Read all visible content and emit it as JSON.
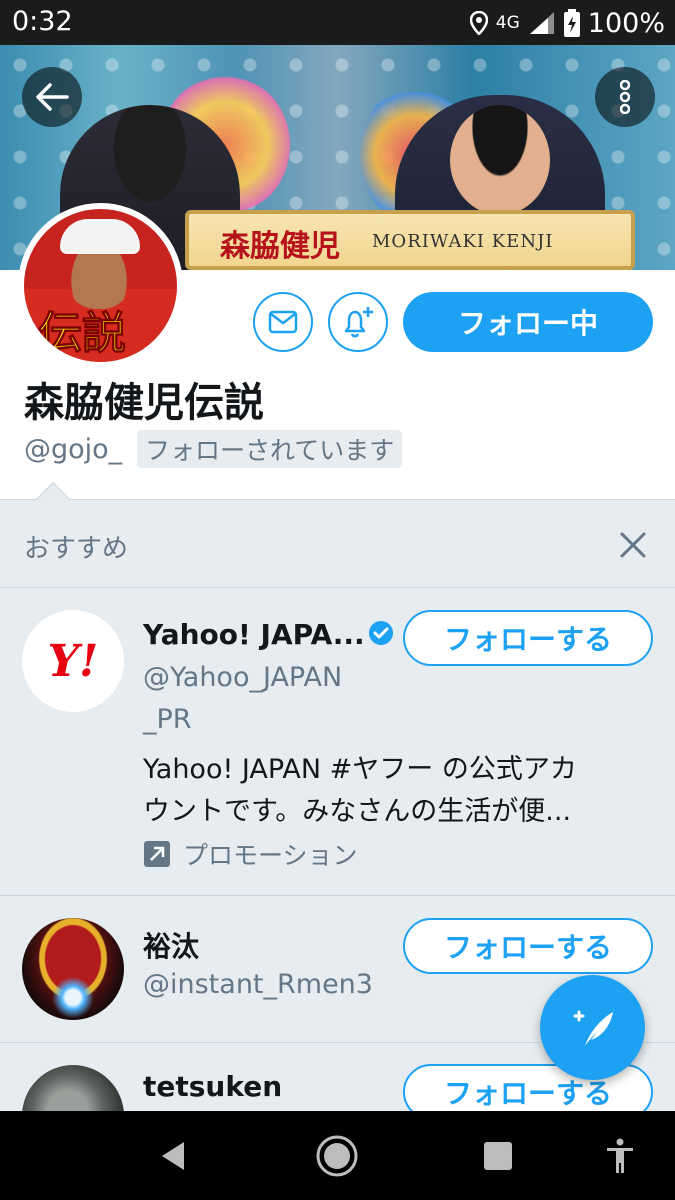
{
  "status_bar": {
    "time": "0:32",
    "network": "4G",
    "battery": "100%"
  },
  "banner": {
    "plate_title": "森脇健児",
    "plate_subtitle": "MORIWAKI KENJI"
  },
  "avatar": {
    "overlay_text": "伝説"
  },
  "profile": {
    "name": "森脇健児伝説",
    "handle": "@gojo_",
    "follows_you": "フォローされています",
    "following_button": "フォロー中"
  },
  "recommendations": {
    "title": "おすすめ",
    "items": [
      {
        "name": "Yahoo! JAPA...",
        "verified": true,
        "handle_line1": "@Yahoo_JAPAN",
        "handle_line2": "_PR",
        "bio_line1": "Yahoo! JAPAN #ヤフー の公式アカ",
        "bio_line2": "ウントです。みなさんの生活が便...",
        "promo": "プロモーション",
        "follow_label": "フォローする",
        "avatar_text": "Y!"
      },
      {
        "name": "裕汰",
        "handle": "@instant_Rmen3",
        "follow_label": "フォローする"
      },
      {
        "name": "tetsuken",
        "follow_label": "フォローする"
      }
    ]
  },
  "colors": {
    "accent": "#1da1f2",
    "panel_bg": "#e6ecf0",
    "secondary_text": "#657786"
  }
}
